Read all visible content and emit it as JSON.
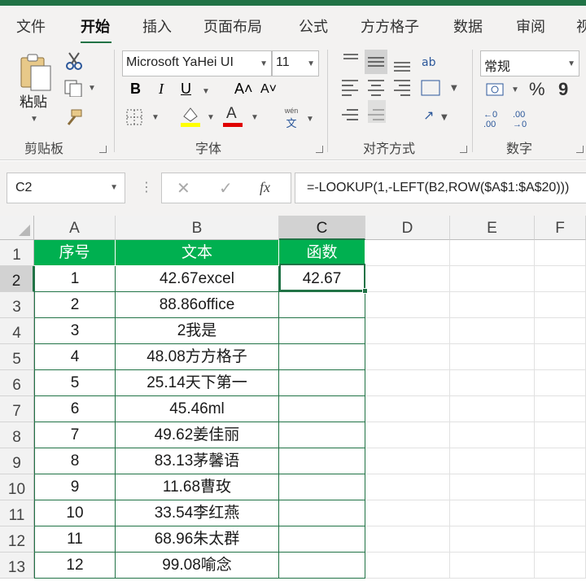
{
  "tabs": [
    "文件",
    "开始",
    "插入",
    "页面布局",
    "公式",
    "方方格子",
    "数据",
    "审阅",
    "视"
  ],
  "ribbon": {
    "clipboard": {
      "paste_label": "粘贴",
      "group_label": "剪贴板"
    },
    "font": {
      "font_name": "Microsoft YaHei UI",
      "font_size": "11",
      "bold": "B",
      "italic": "I",
      "underline": "U",
      "grow": "A˄",
      "shrink": "A˅",
      "phonetic_top": "wén",
      "phonetic_bottom": "文",
      "group_label": "字体"
    },
    "alignment": {
      "group_label": "对齐方式"
    },
    "number": {
      "format": "常规",
      "percent": "%",
      "comma": "9",
      "inc_decimal": "←0 .00",
      "dec_decimal": ".00 →0",
      "group_label": "数字"
    }
  },
  "formula_bar": {
    "name_box": "C2",
    "fx": "fx",
    "formula": "=-LOOKUP(1,-LEFT(B2,ROW($A$1:$A$20)))"
  },
  "columns": [
    "A",
    "B",
    "C",
    "D",
    "E",
    "F"
  ],
  "rows": [
    "1",
    "2",
    "3",
    "4",
    "5",
    "6",
    "7",
    "8",
    "9",
    "10",
    "11",
    "12",
    "13"
  ],
  "headers": [
    "序号",
    "文本",
    "函数"
  ],
  "data": [
    [
      "1",
      "42.67excel",
      "42.67"
    ],
    [
      "2",
      "88.86office",
      ""
    ],
    [
      "3",
      "2我是",
      ""
    ],
    [
      "4",
      "48.08方方格子",
      ""
    ],
    [
      "5",
      "25.14天下第一",
      ""
    ],
    [
      "6",
      "45.46ml",
      ""
    ],
    [
      "7",
      "49.62姜佳丽",
      ""
    ],
    [
      "8",
      "83.13茅馨语",
      ""
    ],
    [
      "9",
      "11.68曹玫",
      ""
    ],
    [
      "10",
      "33.54李红燕",
      ""
    ],
    [
      "11",
      "68.96朱太群",
      ""
    ],
    [
      "12",
      "99.08喻念",
      ""
    ]
  ],
  "colors": {
    "accent": "#217346",
    "header_fill": "#00b050"
  }
}
